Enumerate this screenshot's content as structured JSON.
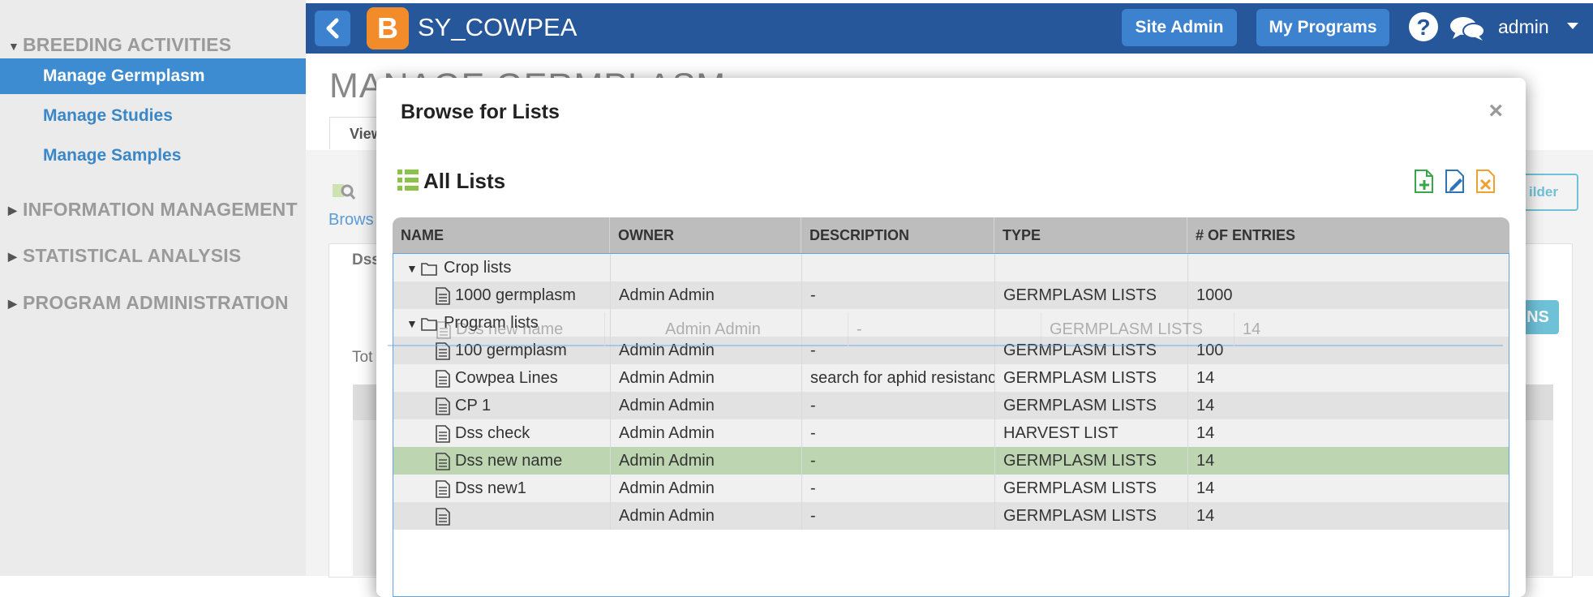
{
  "sidebar": {
    "sections": [
      {
        "label": "BREEDING ACTIVITIES",
        "expanded": true
      },
      {
        "label": "INFORMATION MANAGEMENT",
        "expanded": false
      },
      {
        "label": "STATISTICAL ANALYSIS",
        "expanded": false
      },
      {
        "label": "PROGRAM ADMINISTRATION",
        "expanded": false
      }
    ],
    "items": [
      "Manage Germplasm",
      "Manage Studies",
      "Manage Samples"
    ]
  },
  "topbar": {
    "logo_letter": "B",
    "app_title": "SY_COWPEA",
    "site_admin": "Site Admin",
    "my_programs": "My Programs",
    "help": "?",
    "user": "admin"
  },
  "background": {
    "page_title": "MANAGE GERMPLASM",
    "tab": "View",
    "subtitle": "Brows",
    "dataset_tab": "Dss",
    "total": "Tot",
    "ns_button": "NS",
    "builder_button": "ilder"
  },
  "modal": {
    "title": "Browse for Lists",
    "close": "×",
    "section_title": "All Lists",
    "columns": [
      "NAME",
      "OWNER",
      "DESCRIPTION",
      "TYPE",
      "# OF ENTRIES"
    ],
    "rows": [
      {
        "kind": "folder",
        "name": "Crop lists",
        "owner": "",
        "description": "",
        "type": "",
        "entries": ""
      },
      {
        "kind": "list",
        "name": "1000 germplasm",
        "owner": "Admin Admin",
        "description": "-",
        "type": "GERMPLASM LISTS",
        "entries": "1000"
      },
      {
        "kind": "folder",
        "name": "Program lists",
        "owner": "",
        "description": "",
        "type": "",
        "entries": ""
      },
      {
        "kind": "list",
        "name": "100 germplasm",
        "owner": "Admin Admin",
        "description": "-",
        "type": "GERMPLASM LISTS",
        "entries": "100"
      },
      {
        "kind": "list",
        "name": "Cowpea Lines",
        "owner": "Admin Admin",
        "description": "search for aphid resistance...",
        "type": "GERMPLASM LISTS",
        "entries": "14"
      },
      {
        "kind": "list",
        "name": "CP 1",
        "owner": "Admin Admin",
        "description": "-",
        "type": "GERMPLASM LISTS",
        "entries": "14"
      },
      {
        "kind": "list",
        "name": "Dss check",
        "owner": "Admin Admin",
        "description": "-",
        "type": "HARVEST LIST",
        "entries": "14"
      },
      {
        "kind": "list",
        "name": "Dss new name",
        "owner": "Admin Admin",
        "description": "-",
        "type": "GERMPLASM LISTS",
        "entries": "14",
        "selected": true
      },
      {
        "kind": "list",
        "name": "Dss new1",
        "owner": "Admin Admin",
        "description": "-",
        "type": "GERMPLASM LISTS",
        "entries": "14"
      },
      {
        "kind": "list",
        "name": "",
        "owner": "Admin Admin",
        "description": "-",
        "type": "GERMPLASM LISTS",
        "entries": "14"
      }
    ],
    "drag_ghost": {
      "name": "Dss new name",
      "owner": "Admin Admin",
      "description": "-",
      "type": "GERMPLASM LISTS",
      "entries": "14"
    }
  },
  "colors": {
    "topbar": "#25579a",
    "button": "#3d82cf",
    "sidebar_active": "#3d8bd0",
    "selected_row": "#bdd6b1",
    "logo": "#f28b2a"
  }
}
